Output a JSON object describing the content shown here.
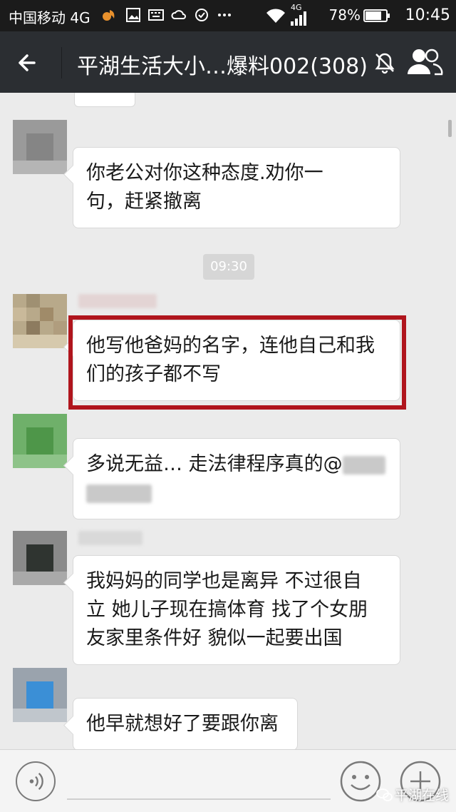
{
  "status_bar": {
    "carrier": "中国移动 4G",
    "battery": "78%",
    "network": "4G",
    "time": "10:45",
    "icons": [
      "squirrel-app-icon",
      "gallery-icon",
      "keyboard-icon",
      "cloud-icon",
      "data-saver-icon",
      "more-icon",
      "wifi-icon",
      "signal-icon",
      "battery-icon"
    ]
  },
  "header": {
    "title": "平湖生活大小…爆料002(308)",
    "icons": [
      "back-arrow-icon",
      "mute-icon",
      "group-members-icon"
    ]
  },
  "chat": {
    "messages": [
      {
        "lines": [
          "你老公对你这种态度.劝你一",
          "句，赶紧撤离"
        ]
      },
      {
        "lines": [
          "他写他爸妈的名字，连他自己和我",
          "们的孩子都不写"
        ],
        "highlighted": true
      },
      {
        "lines": [
          "多说无益… 走法律程序真的@"
        ]
      },
      {
        "lines": [
          "我妈妈的同学也是离异 不过很自",
          "立 她儿子现在搞体育 找了个女朋",
          "友家里条件好 貌似一起要出国"
        ]
      },
      {
        "lines": [
          "他早就想好了要跟你离"
        ]
      }
    ],
    "timestamp": "09:30",
    "highlight_color": "#b0151d"
  },
  "input_bar": {
    "icons": [
      "voice-icon",
      "emoji-icon",
      "plus-icon"
    ]
  },
  "watermark": {
    "text": "平湖在线"
  }
}
